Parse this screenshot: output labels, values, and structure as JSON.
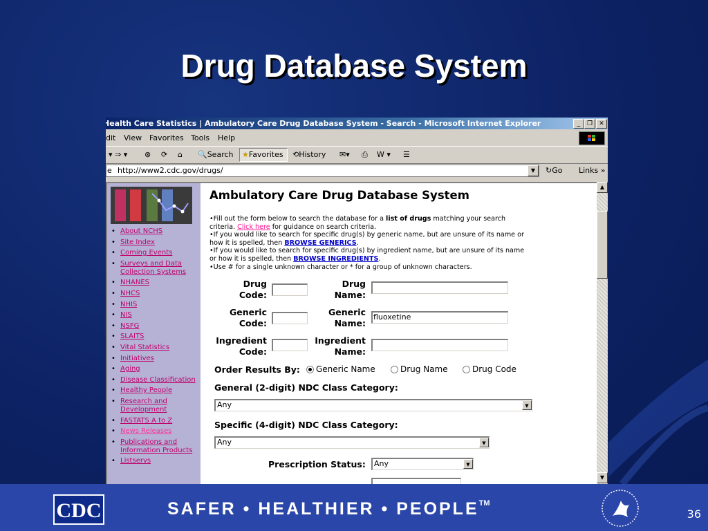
{
  "slide": {
    "title": "Drug Database System",
    "page_number": "36",
    "footer_slogan": "SAFER • HEALTHIER • PEOPLE",
    "footer_trademark": "TM",
    "cdc_logo_text": "CDC"
  },
  "browser": {
    "window_title": "Health Care Statistics | Ambulatory Care Drug Database System - Search - Microsoft Internet Explorer",
    "menu": [
      "dit",
      "View",
      "Favorites",
      "Tools",
      "Help"
    ],
    "toolbar": {
      "search": "Search",
      "favorites": "Favorites",
      "history": "History"
    },
    "address": "http://www2.cdc.gov/drugs/",
    "go": "Go",
    "links": "Links »"
  },
  "sidebar": {
    "items": [
      {
        "label": "About NCHS"
      },
      {
        "label": "Site Index"
      },
      {
        "label": "Coming Events"
      },
      {
        "label": "Surveys and Data Collection Systems"
      },
      {
        "label": "NHANES"
      },
      {
        "label": "NHCS"
      },
      {
        "label": "NHIS"
      },
      {
        "label": "NIS"
      },
      {
        "label": "NSFG"
      },
      {
        "label": "SLAITS"
      },
      {
        "label": "Vital Statistics"
      },
      {
        "label": "Initiatives"
      },
      {
        "label": "Aging"
      },
      {
        "label": "Disease Classification"
      },
      {
        "label": "Healthy People"
      },
      {
        "label": "Research and Development"
      },
      {
        "label": "FASTATS A to Z"
      },
      {
        "label": "News Releases"
      },
      {
        "label": "Publications and Information Products"
      },
      {
        "label": "Listservs"
      }
    ]
  },
  "page": {
    "heading": "Ambulatory Care Drug Database System",
    "instr1_a": "Fill out the form below to search the database for a ",
    "instr1_b": "list of drugs",
    "instr1_c": " matching your search criteria. ",
    "instr1_link": "Click here",
    "instr1_d": " for guidance on search criteria.",
    "instr2_a": "If you would like to search for specific drug(s) by generic name, but are unsure of its name or how it is spelled, then ",
    "instr2_link": "BROWSE GENERICS",
    "instr3_a": "If you would like to search for specific drug(s) by ingredient name, but are unsure of its name or how it is spelled, then ",
    "instr3_link": "BROWSE INGREDIENTS",
    "instr4": "Use # for a single unknown character or * for a group of unknown characters.",
    "drug_code_1": "Drug",
    "drug_code_2": "Code:",
    "drug_name_1": "Drug",
    "drug_name_2": "Name:",
    "generic_code_1": "Generic",
    "generic_code_2": "Code:",
    "generic_name_1": "Generic",
    "generic_name_2": "Name:",
    "ingredient_code_1": "Ingredient",
    "ingredient_code_2": "Code:",
    "ingredient_name_1": "Ingredient",
    "ingredient_name_2": "Name:",
    "generic_name_value": "fluoxetine",
    "order_label": "Order Results By:",
    "order_options": [
      "Generic Name",
      "Drug Name",
      "Drug Code"
    ],
    "general_class_label": "General (2-digit) NDC Class Category:",
    "general_class_value": "Any",
    "specific_class_label": "Specific (4-digit) NDC Class Category:",
    "specific_class_value": "Any",
    "rx_label": "Prescription Status:",
    "rx_value": "Any"
  }
}
